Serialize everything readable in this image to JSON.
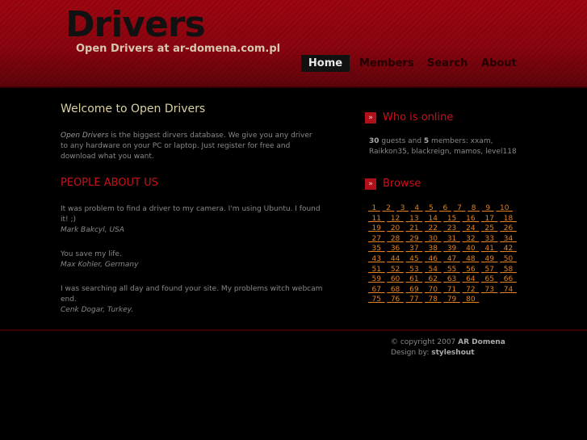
{
  "header": {
    "logo": "Drivers",
    "slogan": "Open Drivers at ar-domena.com.pl"
  },
  "menu": {
    "items": [
      {
        "label": "Home",
        "current": true
      },
      {
        "label": "Members",
        "current": false
      },
      {
        "label": "Search",
        "current": false
      },
      {
        "label": "About",
        "current": false
      }
    ]
  },
  "main": {
    "welcome_title": "Welcome to Open Drivers",
    "intro_brand": "Open Drivers",
    "intro_text": " is the biggest dirvers database. We give you any driver to any hardware on your PC or laptop. Just register for free and download what you want.",
    "people_title": "PEOPLE ABOUT US",
    "quotes": [
      {
        "text": "It was problem to find a driver to my camera. I'm using Ubuntu. I found it! ;)",
        "author": "Mark Bakcyl, USA"
      },
      {
        "text": "You save my life.",
        "author": "Max Kohler, Germany"
      },
      {
        "text": "I was searching all day and found your site. My problems witch webcam end.",
        "author": "Cenk Dogar, Turkey."
      }
    ]
  },
  "sidebar": {
    "bullet": "»",
    "online_title": "Who is online",
    "guests_count": "30",
    "guests_label": " guests and ",
    "members_count": "5",
    "members_label": " members: xxam, Raikkon35, blackreign, mamos, level118",
    "browse_title": "Browse",
    "browse_links": [
      "1",
      "2",
      "3",
      "4",
      "5",
      "6",
      "7",
      "8",
      "9",
      "10",
      "11",
      "12",
      "13",
      "14",
      "15",
      "16",
      "17",
      "18",
      "19",
      "20",
      "21",
      "22",
      "23",
      "24",
      "25",
      "26",
      "27",
      "28",
      "29",
      "30",
      "31",
      "32",
      "33",
      "34",
      "35",
      "36",
      "37",
      "38",
      "39",
      "40",
      "41",
      "42",
      "43",
      "44",
      "45",
      "46",
      "47",
      "48",
      "49",
      "50",
      "51",
      "52",
      "53",
      "54",
      "55",
      "56",
      "57",
      "58",
      "59",
      "60",
      "61",
      "62",
      "63",
      "64",
      "65",
      "66",
      "67",
      "68",
      "69",
      "70",
      "71",
      "72",
      "73",
      "74",
      "75",
      "76",
      "77",
      "78",
      "79",
      "80"
    ]
  },
  "footer": {
    "copyright_prefix": "© copyright 2007 ",
    "copyright_owner": "AR Domena",
    "design_prefix": "Design by: ",
    "design_owner": "styleshout"
  },
  "colors": {
    "header_red": "#a00611",
    "accent_red": "#c8101c",
    "link_orange": "#e08020",
    "welcome_gold": "#d8cfa0"
  }
}
